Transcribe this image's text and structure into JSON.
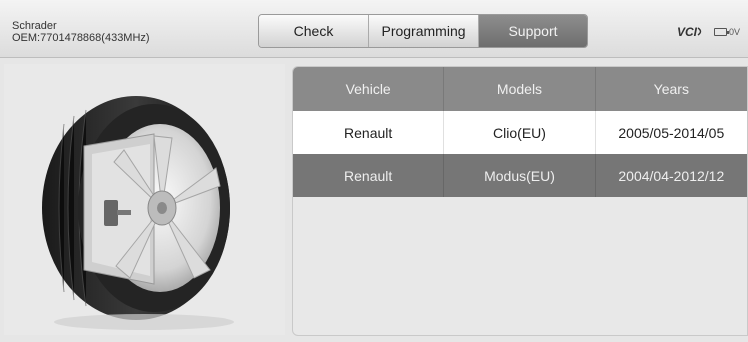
{
  "header": {
    "sensor_brand": "Schrader",
    "oem_line": "OEM:7701478868(433MHz)",
    "tabs": [
      {
        "label": "Check",
        "active": false
      },
      {
        "label": "Programming",
        "active": false
      },
      {
        "label": "Support",
        "active": true
      }
    ],
    "vci_label": "VCI",
    "battery_icon": "battery-icon",
    "battery_voltage": "0V"
  },
  "illustration": {
    "icon": "tire-wheel-image"
  },
  "table": {
    "columns": [
      "Vehicle",
      "Models",
      "Years"
    ],
    "rows": [
      {
        "vehicle": "Renault",
        "model": "Clio(EU)",
        "years": "2005/05-2014/05",
        "state": "selected"
      },
      {
        "vehicle": "Renault",
        "model": "Modus(EU)",
        "years": "2004/04-2012/12",
        "state": "highlighted"
      }
    ]
  },
  "colors": {
    "header_cell": "#8a8a8a",
    "selected_row": "#ffffff",
    "alt_row": "#767676",
    "active_tab": "#7a7a7a"
  }
}
